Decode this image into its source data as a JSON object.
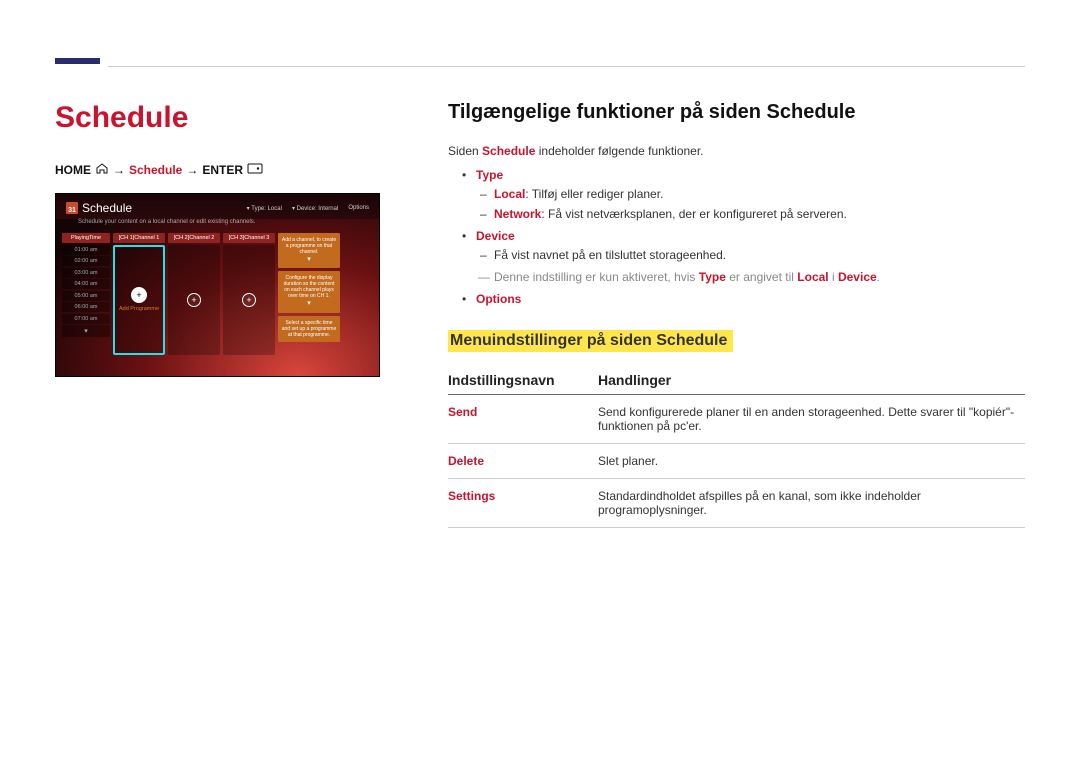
{
  "left": {
    "title": "Schedule",
    "breadcrumb": {
      "home": "HOME",
      "arrow1": "→",
      "schedule": "Schedule",
      "arrow2": "→",
      "enter": "ENTER"
    },
    "mock": {
      "title": "Schedule",
      "cal_day": "31",
      "sub": "Schedule your content on a local channel or edit existing channels.",
      "top_type": "Type: Local",
      "top_device": "Device: Internal",
      "top_options": "Options",
      "times_header": "PlayingTime",
      "times": [
        "01:00 am",
        "02:00 am",
        "03:00 am",
        "04:00 am",
        "05:00 am",
        "06:00 am",
        "07:00 am"
      ],
      "lanes": [
        "[CH 1]Channel 1",
        "[CH 2]Channel 2",
        "[CH 3]Channel 3"
      ],
      "add_programme": "Add Programme",
      "side1": "Add a channel, to create a programme on that channel.",
      "side2": "Configure the display duration so the content on each channel plays over time on CH 1.",
      "side3": "Select a specific time and set up a programme at that programme."
    }
  },
  "right": {
    "h2": "Tilgængelige funktioner på siden Schedule",
    "intro_a": "Siden ",
    "intro_hl": "Schedule",
    "intro_b": " indeholder følgende funktioner.",
    "features": {
      "type": {
        "name": "Type",
        "local_lbl": "Local",
        "local_txt": ": Tilføj eller rediger planer.",
        "network_lbl": "Network",
        "network_txt": ": Få vist netværksplanen, der er konfigureret på serveren."
      },
      "device": {
        "name": "Device",
        "line1": "Få vist navnet på en tilsluttet storageenhed.",
        "note_a": "Denne indstilling er kun aktiveret, hvis ",
        "note_type": "Type",
        "note_b": " er angivet til ",
        "note_local": "Local",
        "note_c": " i ",
        "note_dev": "Device",
        "note_d": "."
      },
      "options": {
        "name": "Options"
      }
    },
    "sub_h": "Menuindstillinger på siden Schedule",
    "table": {
      "th1": "Indstillingsnavn",
      "th2": "Handlinger",
      "rows": [
        {
          "name": "Send",
          "action": "Send konfigurerede planer til en anden storageenhed. Dette svarer til \"kopiér\"-funktionen på pc'er."
        },
        {
          "name": "Delete",
          "action": "Slet planer."
        },
        {
          "name": "Settings",
          "action": "Standardindholdet afspilles på en kanal, som ikke indeholder programoplysninger."
        }
      ]
    }
  }
}
